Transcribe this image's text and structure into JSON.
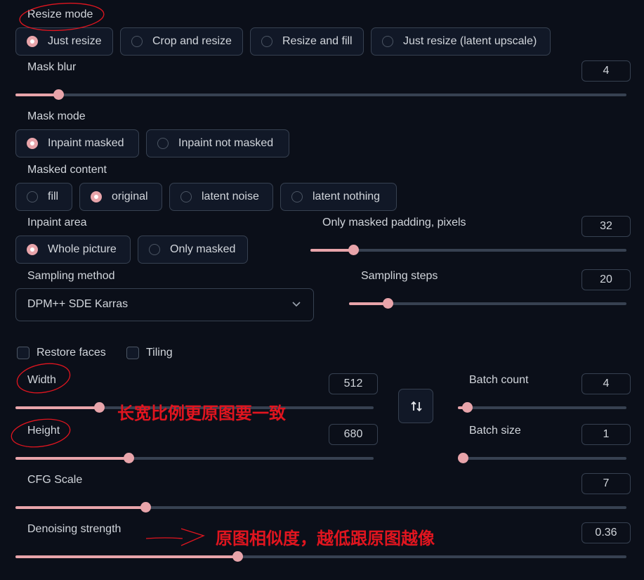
{
  "resize_mode": {
    "label": "Resize mode",
    "options": [
      "Just resize",
      "Crop and resize",
      "Resize and fill",
      "Just resize (latent upscale)"
    ],
    "selected": "Just resize"
  },
  "mask_blur": {
    "label": "Mask blur",
    "value": "4",
    "fraction": 0.07
  },
  "mask_mode": {
    "label": "Mask mode",
    "options": [
      "Inpaint masked",
      "Inpaint not masked"
    ],
    "selected": "Inpaint masked"
  },
  "masked_content": {
    "label": "Masked content",
    "options": [
      "fill",
      "original",
      "latent noise",
      "latent nothing"
    ],
    "selected": "original"
  },
  "inpaint_area": {
    "label": "Inpaint area",
    "options": [
      "Whole picture",
      "Only masked"
    ],
    "selected": "Whole picture"
  },
  "only_masked_padding": {
    "label": "Only masked padding, pixels",
    "value": "32",
    "fraction": 0.13
  },
  "sampling_method": {
    "label": "Sampling method",
    "value": "DPM++ SDE Karras"
  },
  "sampling_steps": {
    "label": "Sampling steps",
    "value": "20",
    "fraction": 0.14
  },
  "restore_faces": {
    "label": "Restore faces",
    "checked": false
  },
  "tiling": {
    "label": "Tiling",
    "checked": false
  },
  "width": {
    "label": "Width",
    "value": "512",
    "fraction": 0.23
  },
  "height": {
    "label": "Height",
    "value": "680",
    "fraction": 0.33
  },
  "batch_count": {
    "label": "Batch count",
    "value": "4",
    "fraction": 0.04
  },
  "batch_size": {
    "label": "Batch size",
    "value": "1",
    "fraction": 0.0
  },
  "cfg_scale": {
    "label": "CFG Scale",
    "value": "7",
    "fraction": 0.21
  },
  "denoising_strength": {
    "label": "Denoising strength",
    "value": "0.36",
    "fraction": 0.36
  },
  "annotations": {
    "aspect_note": "长宽比例更原图要一致",
    "denoise_note": "原图相似度，越低跟原图越像"
  },
  "icons": {
    "swap": "swap-vertical-arrows-icon",
    "dropdown": "chevron-down-icon"
  },
  "colors": {
    "background": "#0b0f19",
    "accent": "#e8a4aa",
    "annotation": "#e0151f"
  }
}
